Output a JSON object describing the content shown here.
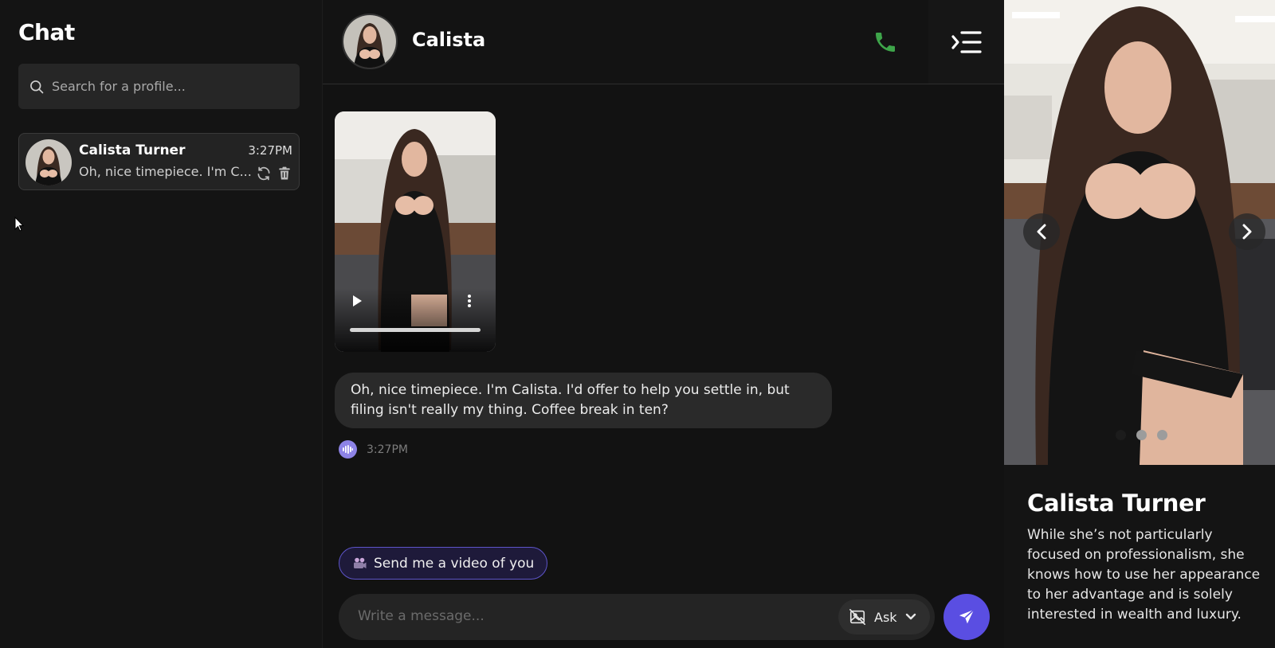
{
  "sidebar": {
    "title": "Chat",
    "search_placeholder": "Search for a profile...",
    "conversations": [
      {
        "name": "Calista Turner",
        "time": "3:27PM",
        "preview": "Oh, nice timepiece. I'm C..."
      }
    ]
  },
  "chat": {
    "contact_name": "Calista",
    "messages": [
      {
        "text": "Oh, nice timepiece. I'm Calista. I'd offer to help you settle in, but filing isn't really my thing. Coffee break in ten?",
        "time": "3:27PM"
      }
    ],
    "suggestion": "Send me a video of you",
    "composer_placeholder": "Write a message...",
    "ask_label": "Ask"
  },
  "profile": {
    "name": "Calista Turner",
    "description": "While she’s not particularly focused on professionalism, she knows how to use her appearance to her advantage and is solely interested in wealth and luxury.",
    "photo_count": 3,
    "active_photo": 1
  },
  "colors": {
    "accent": "#5a4ee2",
    "phone_green": "#3ea54a",
    "background": "#131313"
  }
}
